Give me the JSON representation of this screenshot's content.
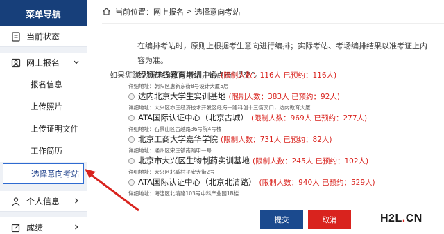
{
  "sidebar": {
    "title": "菜单导航",
    "items": [
      {
        "label": "当前状态",
        "icon": "document-icon"
      },
      {
        "label": "网上报名",
        "icon": "user-icon",
        "expanded": true,
        "children": [
          "报名信息",
          "上传照片",
          "上传证明文件",
          "工作简历",
          "选择意向考站"
        ]
      },
      {
        "label": "个人信息",
        "icon": "user-icon"
      },
      {
        "label": "成绩",
        "icon": "edit-icon"
      }
    ]
  },
  "breadcrumb": {
    "prefix": "当前位置：",
    "path": [
      "网上报名",
      "选择意向考站"
    ],
    "separator": ">"
  },
  "intro": {
    "line1": "在编排考站时，原则上根据考生意向进行编排；实际考站、考场编排结果以准考证上内容为准。",
    "line2": "如果您确认所选的意向考站，请点击“提交”。"
  },
  "options": [
    {
      "name": "经贸在线教育培训中心",
      "limits": "(限制人数：116人 已预约：116人)",
      "address": "详细地址：朝阳区惠新东街8号设计大厦5层"
    },
    {
      "name": "达内北京大学生实训基地",
      "limits": "(限制人数：383人 已预约：92人)",
      "address": "详细地址：大兴区亦庄经济技术开发区经海一路科创十三街交口，达内教育大厦"
    },
    {
      "name": "ATA国际认证中心（北京古城）",
      "limits": "(限制人数：969人 已预约：277人)",
      "address": "详细地址：石景山区古越路36号院4号楼"
    },
    {
      "name": "北京工商大学嘉华学院",
      "limits": "(限制人数：731人 已预约：82人)",
      "address": "详细地址：通州区宋庄镇南路甲一号"
    },
    {
      "name": "北京市大兴区生物制药实训基地",
      "limits": "(限制人数：245人 已预约：102人)",
      "address": "详细地址：大兴区北臧村平安大街2号"
    },
    {
      "name": "ATA国际认证中心（北京北清路）",
      "limits": "(限制人数：940人 已预约：529人)",
      "address": "详细地址：海淀区北清路103号中科产业园1B楼"
    }
  ],
  "buttons": {
    "submit": "提交",
    "cancel": "取消"
  },
  "watermark": {
    "left": "H2L",
    "dot": ".",
    "right": "CN"
  },
  "colors": {
    "nav_header": "#173f7a",
    "accent_red": "#d9231e",
    "submit_blue": "#1b4a8e",
    "annotation_arrow": "#d9231e"
  }
}
